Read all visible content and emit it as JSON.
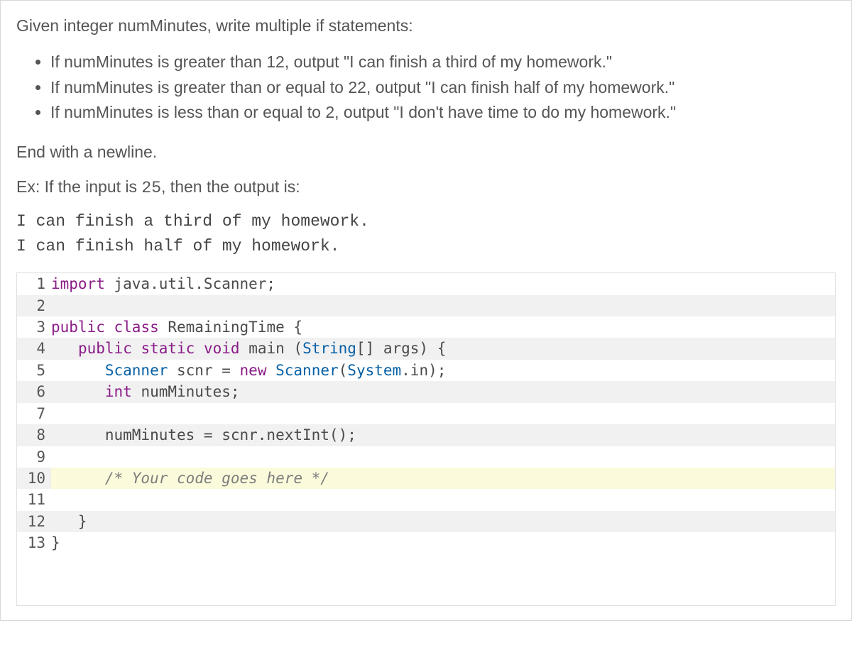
{
  "intro": "Given integer numMinutes, write multiple if statements:",
  "bullets": [
    "If numMinutes is greater than 12, output \"I can finish a third of my homework.\"",
    "If numMinutes is greater than or equal to 22, output \"I can finish half of my homework.\"",
    "If numMinutes is less than or equal to 2, output \"I don't have time to do my homework.\""
  ],
  "endline": "End with a newline.",
  "example_prefix": "Ex: If the input is ",
  "example_value": "25",
  "example_suffix": ", then the output is:",
  "output_lines": [
    "I can finish a third of my homework.",
    "I can finish half of my homework."
  ],
  "code": {
    "lines": [
      {
        "n": 1,
        "tokens": [
          {
            "t": "import",
            "c": "kw"
          },
          {
            "t": " java.util.Scanner;",
            "c": ""
          }
        ]
      },
      {
        "n": 2,
        "tokens": [
          {
            "t": "",
            "c": ""
          }
        ]
      },
      {
        "n": 3,
        "tokens": [
          {
            "t": "public",
            "c": "kw"
          },
          {
            "t": " ",
            "c": ""
          },
          {
            "t": "class",
            "c": "kw"
          },
          {
            "t": " RemainingTime {",
            "c": ""
          }
        ]
      },
      {
        "n": 4,
        "tokens": [
          {
            "t": "   ",
            "c": ""
          },
          {
            "t": "public",
            "c": "kw"
          },
          {
            "t": " ",
            "c": ""
          },
          {
            "t": "static",
            "c": "kw"
          },
          {
            "t": " ",
            "c": ""
          },
          {
            "t": "void",
            "c": "kw"
          },
          {
            "t": " main (",
            "c": ""
          },
          {
            "t": "String",
            "c": "cls"
          },
          {
            "t": "[] args) {",
            "c": ""
          }
        ]
      },
      {
        "n": 5,
        "tokens": [
          {
            "t": "      ",
            "c": ""
          },
          {
            "t": "Scanner",
            "c": "cls"
          },
          {
            "t": " scnr = ",
            "c": ""
          },
          {
            "t": "new",
            "c": "kw"
          },
          {
            "t": " ",
            "c": ""
          },
          {
            "t": "Scanner",
            "c": "cls"
          },
          {
            "t": "(",
            "c": ""
          },
          {
            "t": "System",
            "c": "cls"
          },
          {
            "t": ".in);",
            "c": ""
          }
        ]
      },
      {
        "n": 6,
        "tokens": [
          {
            "t": "      ",
            "c": ""
          },
          {
            "t": "int",
            "c": "kw"
          },
          {
            "t": " numMinutes;",
            "c": ""
          }
        ]
      },
      {
        "n": 7,
        "tokens": [
          {
            "t": "",
            "c": ""
          }
        ]
      },
      {
        "n": 8,
        "tokens": [
          {
            "t": "      numMinutes = scnr.nextInt();",
            "c": ""
          }
        ]
      },
      {
        "n": 9,
        "tokens": [
          {
            "t": "",
            "c": ""
          }
        ]
      },
      {
        "n": 10,
        "hl": true,
        "tokens": [
          {
            "t": "      ",
            "c": ""
          },
          {
            "t": "/* Your code goes here */",
            "c": "cmt"
          }
        ]
      },
      {
        "n": 11,
        "tokens": [
          {
            "t": "",
            "c": ""
          }
        ]
      },
      {
        "n": 12,
        "tokens": [
          {
            "t": "   }",
            "c": ""
          }
        ]
      },
      {
        "n": 13,
        "tokens": [
          {
            "t": "}",
            "c": ""
          }
        ]
      }
    ]
  }
}
